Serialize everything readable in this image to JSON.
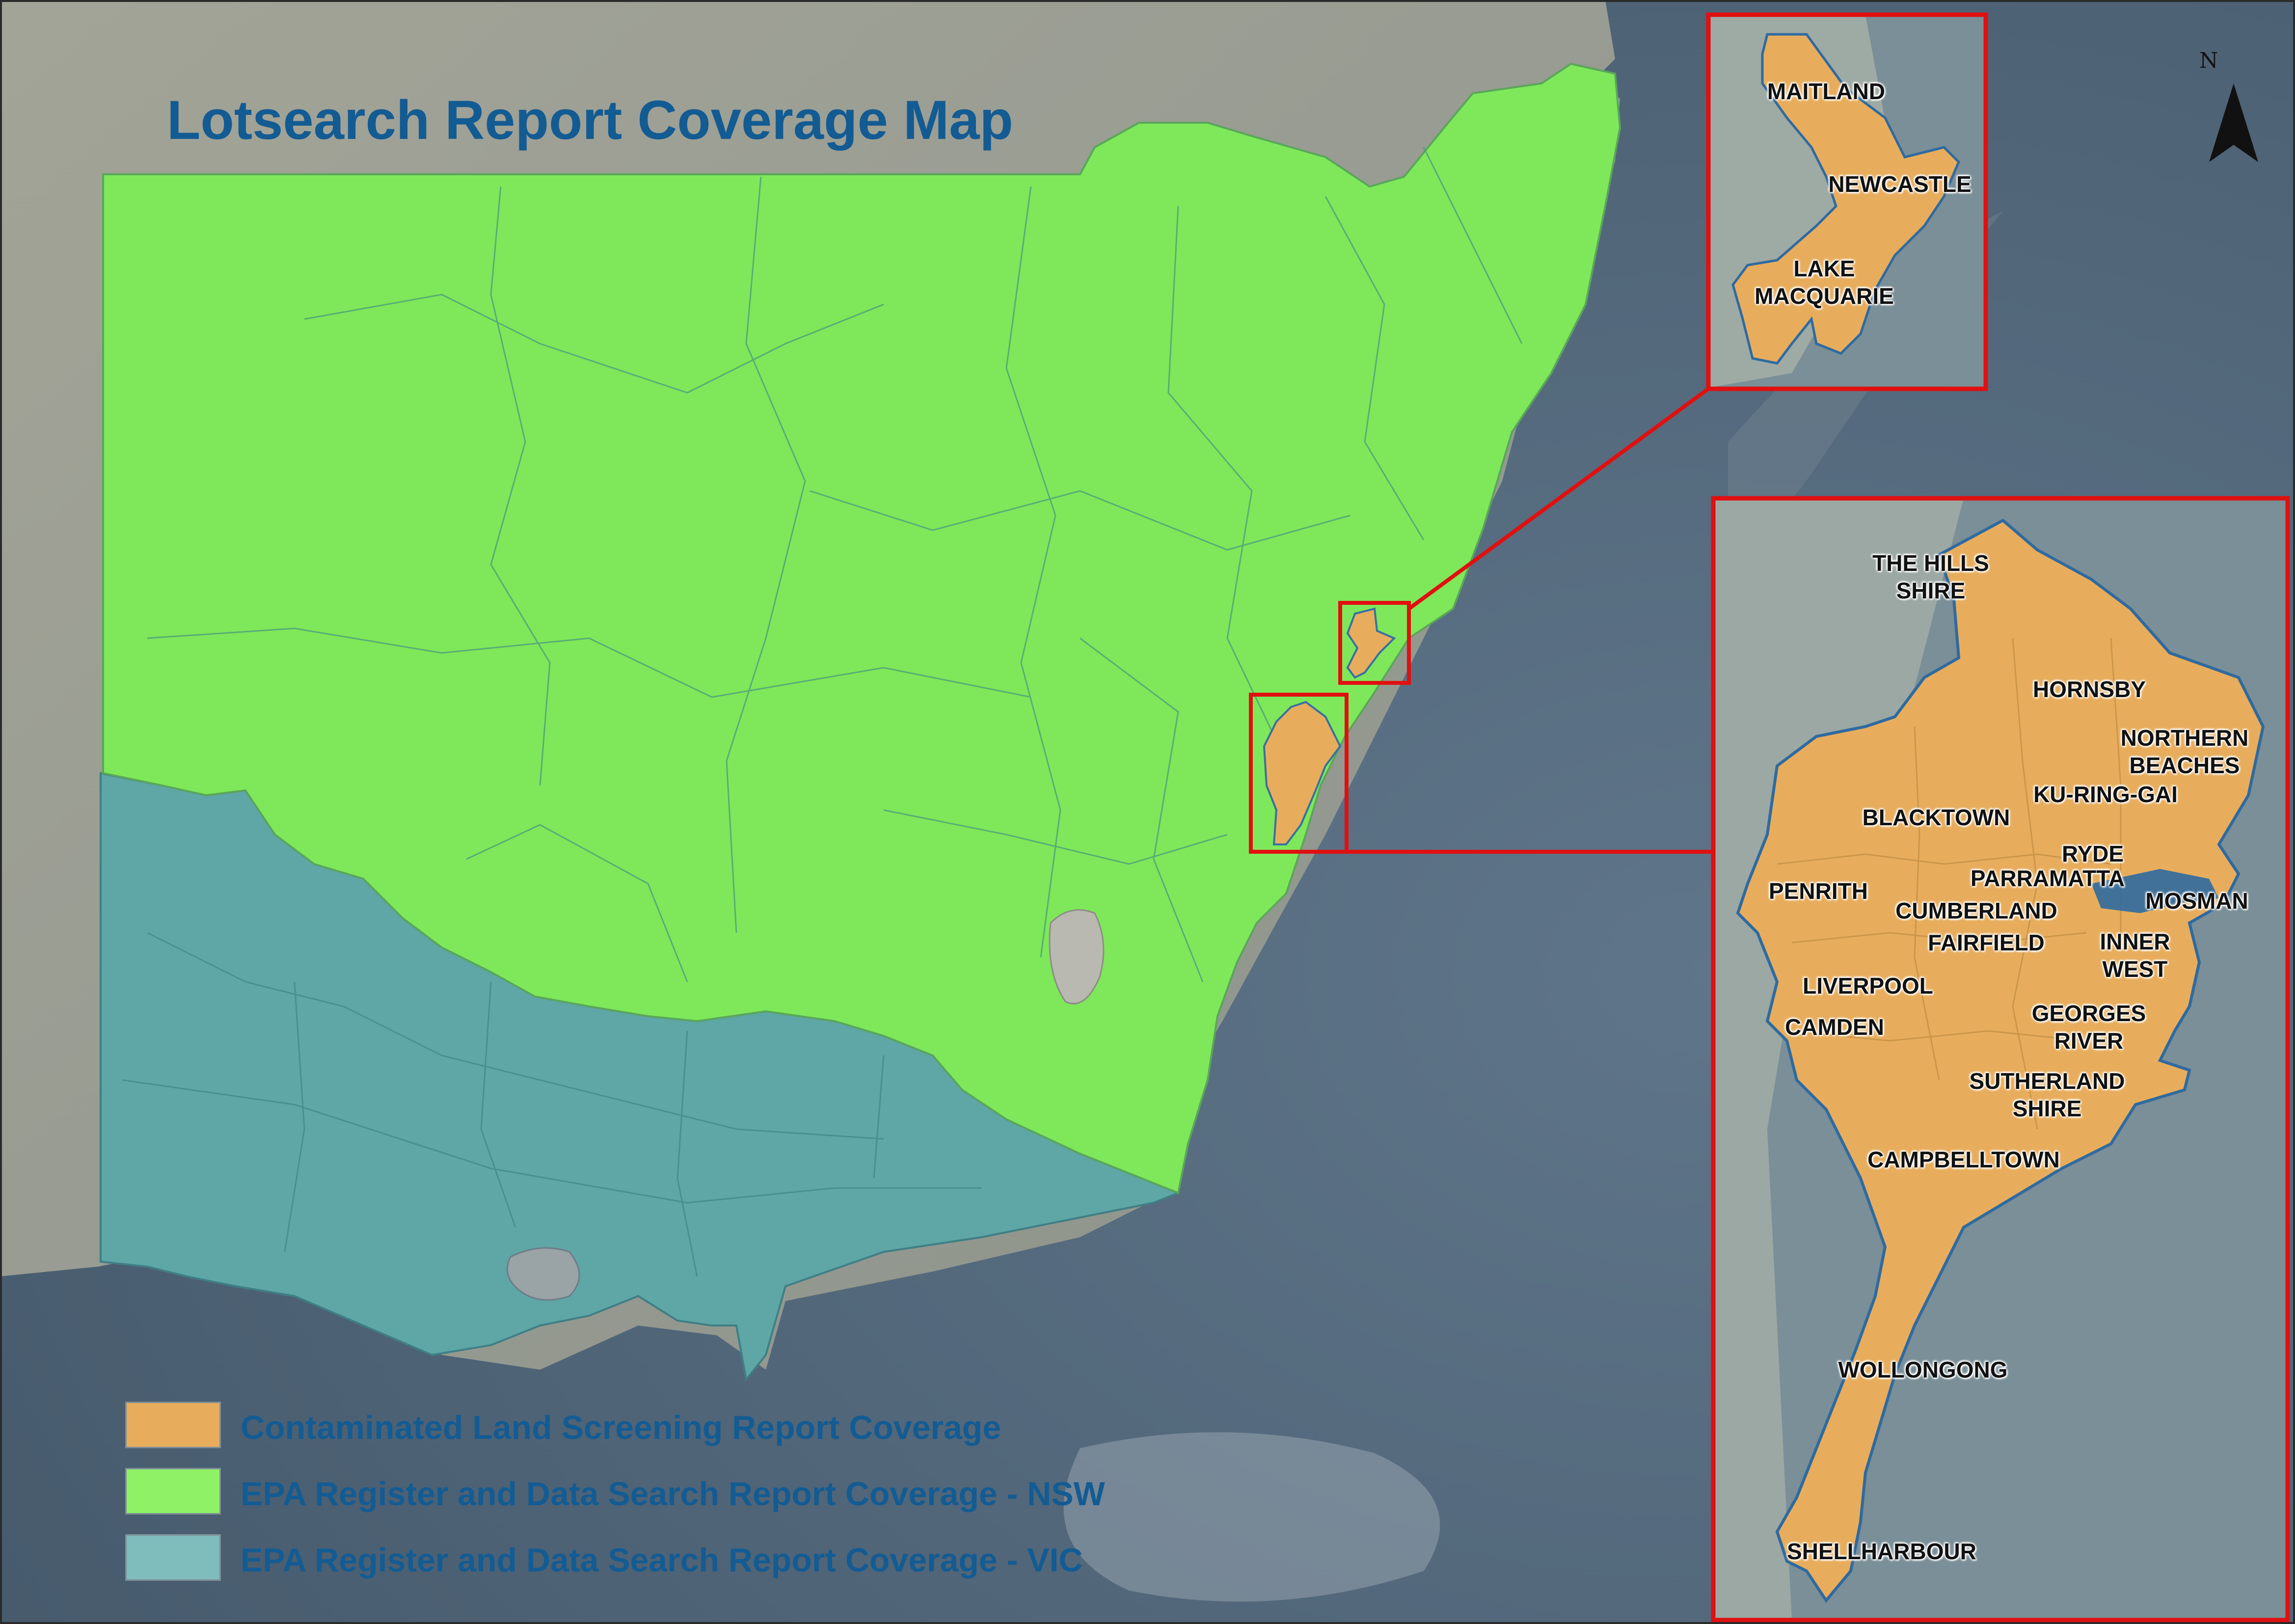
{
  "title": "Lotsearch Report Coverage Map",
  "north_arrow": {
    "label": "N",
    "icon": "north-arrow-icon"
  },
  "colors": {
    "contaminated_land": "#e8ad5c",
    "nsw": "#7ee85a",
    "vic": "#5ea7a6",
    "inset_border": "#e01010",
    "title": "#135b93",
    "water": "#50657a"
  },
  "legend": [
    {
      "key": "contaminated_land",
      "label": "Contaminated Land Screening Report Coverage",
      "color": "#e8ad5c"
    },
    {
      "key": "nsw",
      "label": "EPA Register and Data Search Report Coverage - NSW",
      "color": "#7ee85a"
    },
    {
      "key": "vic",
      "label": "EPA Register and Data Search Report Coverage - VIC",
      "color": "#7fbcbc"
    }
  ],
  "inset_newcastle": {
    "labels": [
      "MAITLAND",
      "NEWCASTLE",
      "LAKE\nMACQUARIE"
    ]
  },
  "inset_sydney": {
    "labels": [
      "THE HILLS\nSHIRE",
      "HORNSBY",
      "NORTHERN\nBEACHES",
      "KU-RING-GAI",
      "BLACKTOWN",
      "RYDE",
      "PARRAMATTA",
      "PENRITH",
      "CUMBERLAND",
      "MOSMAN",
      "FAIRFIELD",
      "INNER\nWEST",
      "LIVERPOOL",
      "GEORGES\nRIVER",
      "CAMDEN",
      "SUTHERLAND\nSHIRE",
      "CAMPBELLTOWN",
      "WOLLONGONG",
      "SHELLHARBOUR"
    ]
  }
}
